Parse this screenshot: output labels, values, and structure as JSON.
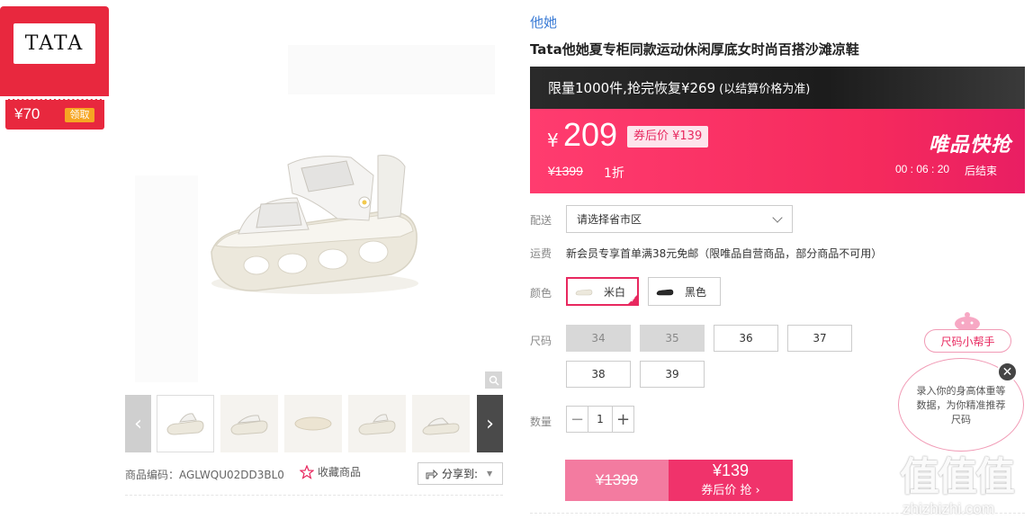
{
  "coupon": {
    "brand": "TATA",
    "amount": "¥70",
    "get_label": "领取"
  },
  "gallery": {
    "thumbnail_count": 5,
    "sku_code": "商品编码：AGLWQU02DD3BL0",
    "favorite_label": "收藏商品",
    "share_label": "分享到:"
  },
  "product": {
    "brand_link": "他她",
    "title": "Tata他她夏专柜同款运动休闲厚底女时尚百搭沙滩凉鞋"
  },
  "promo": {
    "main": "限量1000件,抢完恢复¥269",
    "sub": "(以结算价格为准)"
  },
  "price": {
    "currency": "¥",
    "current": "209",
    "after_coupon": "券后价 ¥139",
    "original": "¥1399",
    "discount": "1折",
    "flash_logo": "唯品快抢",
    "countdown": "00 : 06 : 20",
    "countdown_label": "后结束"
  },
  "delivery": {
    "label": "配送",
    "placeholder": "请选择省市区"
  },
  "freight": {
    "label": "运费",
    "text": "新会员专享首单满38元免邮（限唯品自营商品，部分商品不可用）"
  },
  "color": {
    "label": "颜色",
    "options": [
      {
        "name": "米白",
        "selected": true
      },
      {
        "name": "黑色",
        "selected": false
      }
    ]
  },
  "size": {
    "label": "尺码",
    "options": [
      {
        "value": "34",
        "available": false
      },
      {
        "value": "35",
        "available": false
      },
      {
        "value": "36",
        "available": true
      },
      {
        "value": "37",
        "available": true
      },
      {
        "value": "38",
        "available": true
      },
      {
        "value": "39",
        "available": true
      }
    ]
  },
  "quantity": {
    "label": "数量",
    "minus": "−",
    "value": "1",
    "plus": "+"
  },
  "buy": {
    "original_price": "¥1399",
    "price": "¥139",
    "label": "券后价 抢 ›"
  },
  "size_helper": {
    "title": "尺码小帮手",
    "text": "录入你的身高体重等数据，为你精准推荐尺码",
    "close": "✕"
  },
  "watermark": {
    "cn": "值值值",
    "en": "zhizhizhi.com"
  },
  "colors": {
    "accent": "#e8285f",
    "brand_red": "#e8283e",
    "link_blue": "#3a7bd5"
  }
}
